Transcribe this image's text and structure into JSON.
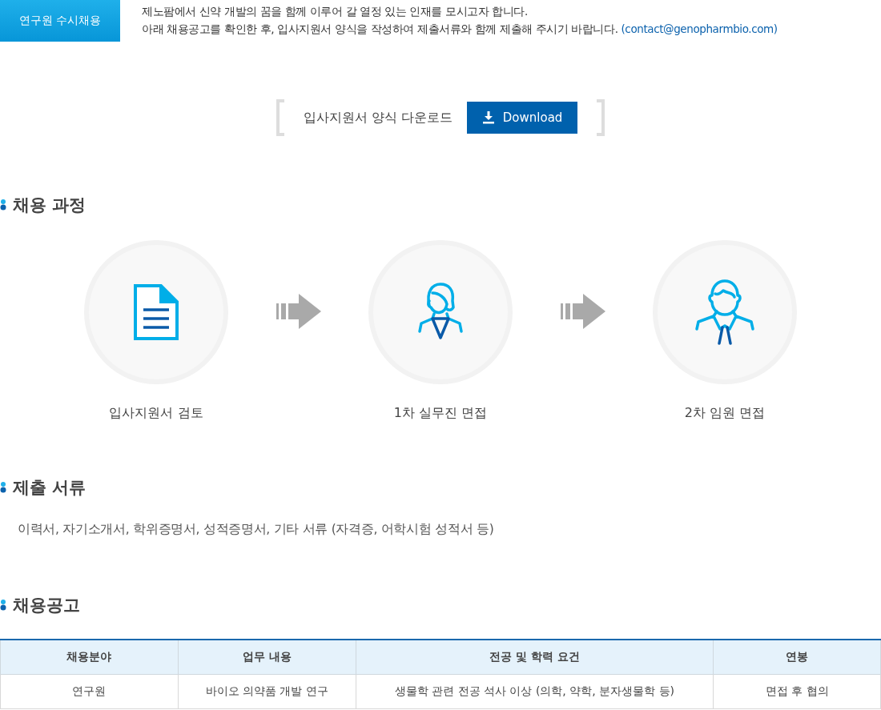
{
  "header": {
    "badge": "연구원 수시채용",
    "lines": [
      "제노팜에서 신약 개발의 꿈을 함께 이루어 갈 열정 있는 인재를 모시고자 합니다.",
      "아래 채용공고를 확인한 후, 입사지원서 양식을 작성하여 제출서류와 함께 제출해 주시기 바랍니다."
    ],
    "email": "(contact@genopharmbio.com)"
  },
  "download": {
    "label": "입사지원서 양식 다운로드",
    "button": "Download"
  },
  "process": {
    "title": "채용 과정",
    "steps": [
      {
        "kind": "document",
        "label": "입사지원서 검토"
      },
      {
        "kind": "woman",
        "label": "1차 실무진 면접"
      },
      {
        "kind": "man",
        "label": "2차 임원 면접"
      }
    ]
  },
  "documents": {
    "title": "제출 서류",
    "text": "이력서, 자기소개서, 학위증명서, 성적증명서, 기타 서류 (자격증, 어학시험 성적서 등)"
  },
  "posting": {
    "title": "채용공고",
    "columns": [
      "채용분야",
      "업무 내용",
      "전공 및 학력 요건",
      "연봉"
    ],
    "rows": [
      [
        "연구원",
        "바이오 의약품 개발 연구",
        "생물학 관련 전공 석사 이상 (의학, 약학, 분자생물학 등)",
        "면접 후 협의"
      ]
    ]
  }
}
